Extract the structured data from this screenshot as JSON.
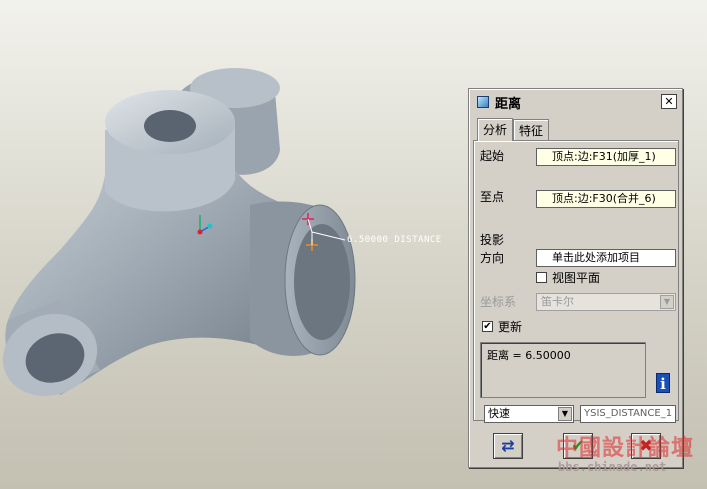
{
  "viewport": {
    "measure_label": "6.50000  DISTANCE"
  },
  "dialog": {
    "title": "距离",
    "close_label": "✕",
    "tabs": [
      {
        "label": "分析",
        "active": true
      },
      {
        "label": "特征",
        "active": false
      }
    ],
    "from_label": "起始",
    "from_value": "顶点:边:F31(加厚_1)",
    "to_label": "至点",
    "to_value": "顶点:边:F30(合并_6)",
    "projection_label_1": "投影",
    "projection_label_2": "方向",
    "projection_placeholder": "单击此处添加项目",
    "view_plane_label": "视图平面",
    "view_plane_checked": false,
    "coord_label": "坐标系",
    "coord_value": "笛卡尔",
    "update_label": "更新",
    "update_checked": true,
    "result_text": "距离 = 6.50000",
    "info_icon_glyph": "i",
    "mode_value": "快速",
    "analysis_name": "YSIS_DISTANCE_1",
    "repeat_glyph": "⇄",
    "ok_glyph": "✔",
    "cancel_glyph": "✖"
  },
  "watermark": {
    "title": "中國設計論壇",
    "url": "bbs.chinade.net"
  },
  "colors": {
    "part_body": "#8d98a3",
    "start_point": "#e0205a",
    "end_point": "#f08a20",
    "ok": "#1a9a1a",
    "cancel": "#c02020",
    "repeat": "#1a3fa0"
  }
}
